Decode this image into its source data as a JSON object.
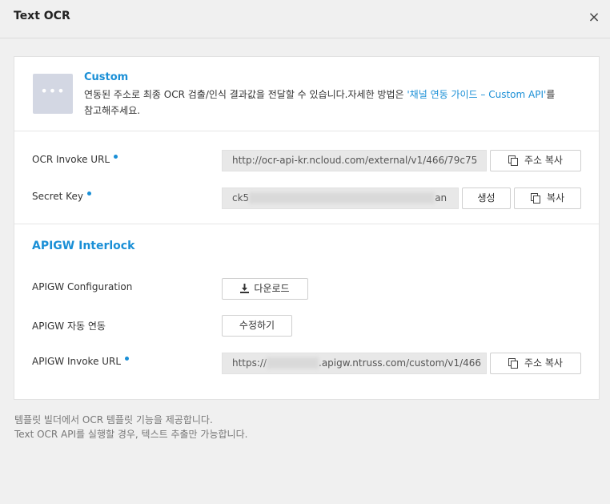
{
  "dialog": {
    "title": "Text OCR",
    "close_label": "×"
  },
  "custom": {
    "icon_glyph": "•••",
    "title": "Custom",
    "desc_prefix": "연동된 주소로 최종 OCR 검출/인식 결과값을 전달할 수 있습니다.자세한 방법은 ",
    "desc_link": "'채널 연동 가이드 – Custom API'",
    "desc_suffix": "를 참고해주세요."
  },
  "ocr_invoke": {
    "label": "OCR Invoke URL",
    "value": "http://ocr-api-kr.ncloud.com/external/v1/466/79c75",
    "copy_label": "주소 복사"
  },
  "secret_key": {
    "label": "Secret Key",
    "value_prefix": "ck5",
    "value_suffix": "an",
    "generate_label": "생성",
    "copy_label": "복사"
  },
  "apigw": {
    "section_title": "APIGW Interlock",
    "config_label": "APIGW Configuration",
    "download_label": "다운로드",
    "auto_label": "APIGW 자동 연동",
    "edit_label": "수정하기",
    "invoke_label": "APIGW Invoke URL",
    "invoke_prefix": "https://",
    "invoke_suffix": ".apigw.ntruss.com/custom/v1/466",
    "copy_label": "주소 복사"
  },
  "footer": {
    "line1": "템플릿 빌더에서 OCR 템플릿 기능을 제공합니다.",
    "line2": "Text OCR API를 실행할 경우, 텍스트 추출만 가능합니다."
  }
}
